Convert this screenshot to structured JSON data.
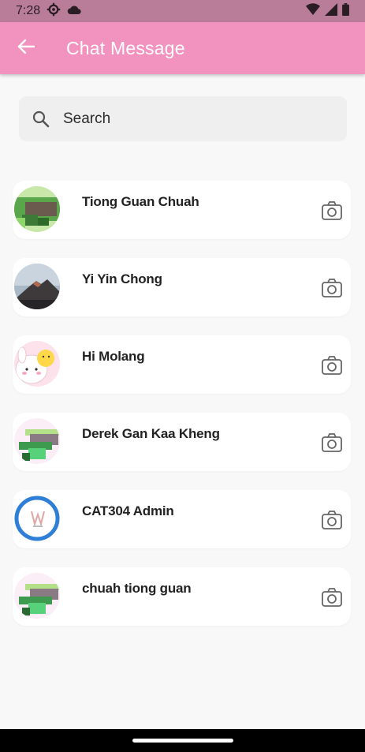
{
  "status_bar": {
    "time": "7:28",
    "icons": [
      "settings-icon",
      "cloud-icon",
      "wifi-icon",
      "signal-icon",
      "battery-icon"
    ]
  },
  "app_bar": {
    "title": "Chat Message",
    "back_icon": "arrow-left-icon",
    "background": "#f292bf"
  },
  "search": {
    "placeholder": "Search",
    "value": ""
  },
  "contacts": [
    {
      "name": "Tiong Guan Chuah",
      "avatar": "pixel-avatar"
    },
    {
      "name": "Yi Yin Chong",
      "avatar": "mountain-photo"
    },
    {
      "name": "Hi Molang",
      "avatar": "molang-rabbit"
    },
    {
      "name": "Derek Gan Kaa Kheng",
      "avatar": "pixel-avatar"
    },
    {
      "name": "CAT304 Admin",
      "avatar": "logo-blue-ring"
    },
    {
      "name": "chuah tiong guan",
      "avatar": "pixel-avatar"
    }
  ],
  "action_icon": "camera-icon"
}
